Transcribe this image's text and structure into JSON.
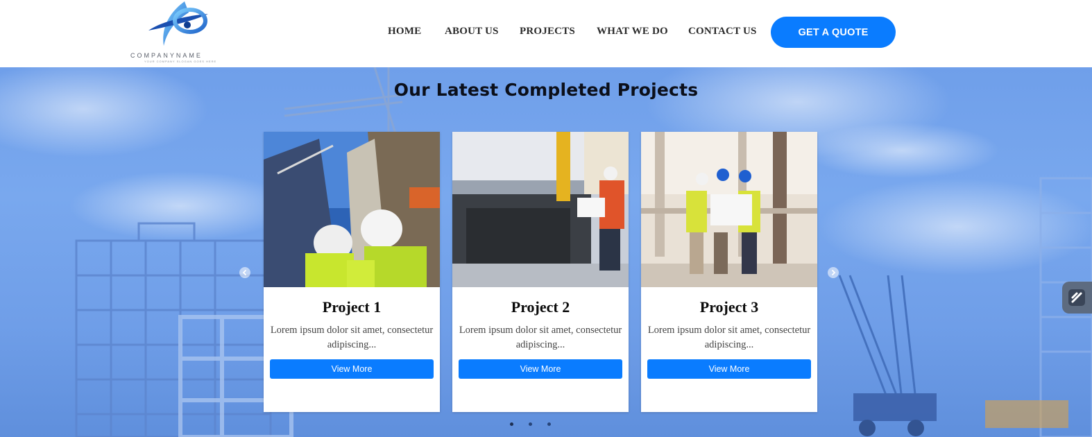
{
  "header": {
    "logo": {
      "name": "COMPANYNAME",
      "tagline": "YOUR COMPANY SLOGAN GOES HERE"
    },
    "nav": [
      {
        "label": "HOME"
      },
      {
        "label": "ABOUT US"
      },
      {
        "label": "PROJECTS"
      },
      {
        "label": "WHAT WE DO"
      },
      {
        "label": "CONTACT US"
      }
    ],
    "cta_label": "GET A QUOTE"
  },
  "section": {
    "title": "Our Latest Completed Projects",
    "projects": [
      {
        "title": "Project 1",
        "description": "Lorem ipsum dolor sit amet, consectetur adipiscing...",
        "button": "View More"
      },
      {
        "title": "Project 2",
        "description": "Lorem ipsum dolor sit amet, consectetur adipiscing...",
        "button": "View More"
      },
      {
        "title": "Project 3",
        "description": "Lorem ipsum dolor sit amet, consectetur adipiscing...",
        "button": "View More"
      }
    ],
    "carousel": {
      "active_dot": 1,
      "dot_count": 3
    }
  },
  "colors": {
    "accent": "#0a7cff",
    "hero_blue": "#6f9fea",
    "nav_text": "#2a2a2a"
  },
  "icons": {
    "prev": "chevron-left-icon",
    "next": "chevron-right-icon",
    "side": "pen-icon"
  }
}
